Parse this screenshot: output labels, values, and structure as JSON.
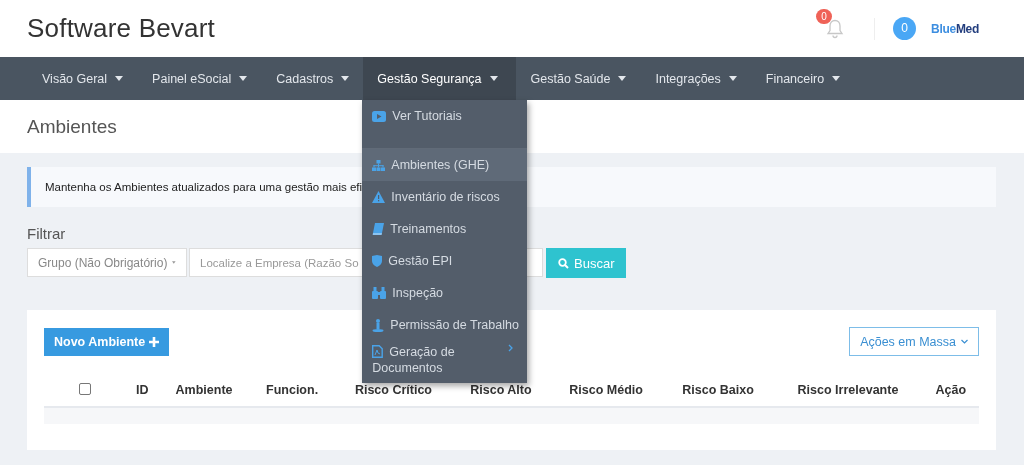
{
  "header": {
    "title": "Software Bevart",
    "notifications_count": "0",
    "messages_count": "0",
    "logo_primary": "Blue",
    "logo_secondary": "Med"
  },
  "nav": {
    "items": [
      {
        "label": "Visão Geral",
        "selected": false
      },
      {
        "label": "Painel eSocial",
        "selected": false
      },
      {
        "label": "Cadastros",
        "selected": false
      },
      {
        "label": "Gestão Segurança",
        "selected": true
      },
      {
        "label": "Gestão Saúde",
        "selected": false
      },
      {
        "label": "Integrações",
        "selected": false
      },
      {
        "label": "Financeiro",
        "selected": false
      }
    ]
  },
  "dropdown": {
    "items": [
      {
        "kind": "play",
        "label": "Ver Tutoriais",
        "selected": false,
        "separator_after": true
      },
      {
        "kind": "sitemap",
        "label": "Ambientes (GHE)",
        "selected": true
      },
      {
        "kind": "warning",
        "label": "Inventário de riscos",
        "selected": false
      },
      {
        "kind": "book",
        "label": "Treinamentos",
        "selected": false
      },
      {
        "kind": "shield",
        "label": "Gestão EPI",
        "selected": false
      },
      {
        "kind": "binoculars",
        "label": "Inspeção",
        "selected": false
      },
      {
        "kind": "person",
        "label": "Permissão de Trabalho",
        "selected": false
      },
      {
        "kind": "pdf",
        "label": "Geração de Documentos",
        "selected": false,
        "submenu": true
      }
    ]
  },
  "page_title": "Ambientes",
  "alert": "Mantenha os Ambientes atualizados para uma gestão mais efi",
  "filter": {
    "label": "Filtrar",
    "group_select": "Grupo (Não Obrigatório)",
    "company_placeholder": "Localize a Empresa (Razão So",
    "search_button": "Buscar"
  },
  "card": {
    "new_button": "Novo Ambiente",
    "bulk_button": "Ações em Massa",
    "table": {
      "columns": [
        {
          "kind": "checkbox",
          "checked": false
        },
        {
          "kind": "text",
          "label": "ID"
        },
        {
          "kind": "text",
          "label": "Ambiente"
        },
        {
          "kind": "text",
          "label": "Funcion."
        },
        {
          "kind": "text",
          "label": "Risco Crítico"
        },
        {
          "kind": "text",
          "label": "Risco Alto"
        },
        {
          "kind": "text",
          "label": "Risco Médio"
        },
        {
          "kind": "text",
          "label": "Risco Baixo"
        },
        {
          "kind": "text",
          "label": "Risco Irrelevante"
        },
        {
          "kind": "text",
          "label": "Ação"
        }
      ]
    }
  }
}
